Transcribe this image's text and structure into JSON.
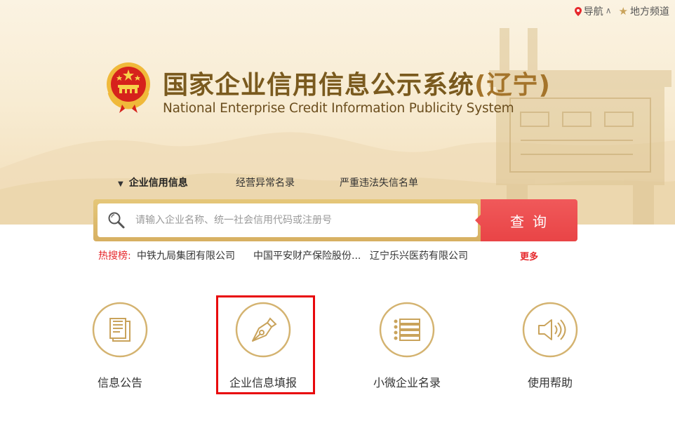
{
  "toplinks": {
    "nav_label": "导航",
    "region_label": "地方频道"
  },
  "header": {
    "title_main": "国家企业信用信息公示系统",
    "title_region": "(辽宁)",
    "title_en": "National Enterprise Credit Information Publicity System"
  },
  "tabs": [
    {
      "label": "企业信用信息",
      "active": true
    },
    {
      "label": "经营异常名录",
      "active": false
    },
    {
      "label": "严重违法失信名单",
      "active": false
    }
  ],
  "search": {
    "placeholder": "请输入企业名称、统一社会信用代码或注册号",
    "button_label": "查询"
  },
  "hot_search": {
    "label": "热搜榜:",
    "items": [
      "中铁九局集团有限公司",
      "中国平安财产保险股份...",
      "辽宁乐兴医药有限公司"
    ],
    "more_label": "更多"
  },
  "features": [
    {
      "label": "信息公告",
      "icon": "document-icon"
    },
    {
      "label": "企业信息填报",
      "icon": "pen-nib-icon"
    },
    {
      "label": "小微企业名录",
      "icon": "list-icon"
    },
    {
      "label": "使用帮助",
      "icon": "speaker-icon"
    }
  ],
  "colors": {
    "accent_gold": "#c9a35b",
    "search_button_red": "#e94446",
    "hot_label_red": "#e6282c",
    "highlight_red": "#e8080c",
    "title_brown": "#7a5a1e"
  }
}
